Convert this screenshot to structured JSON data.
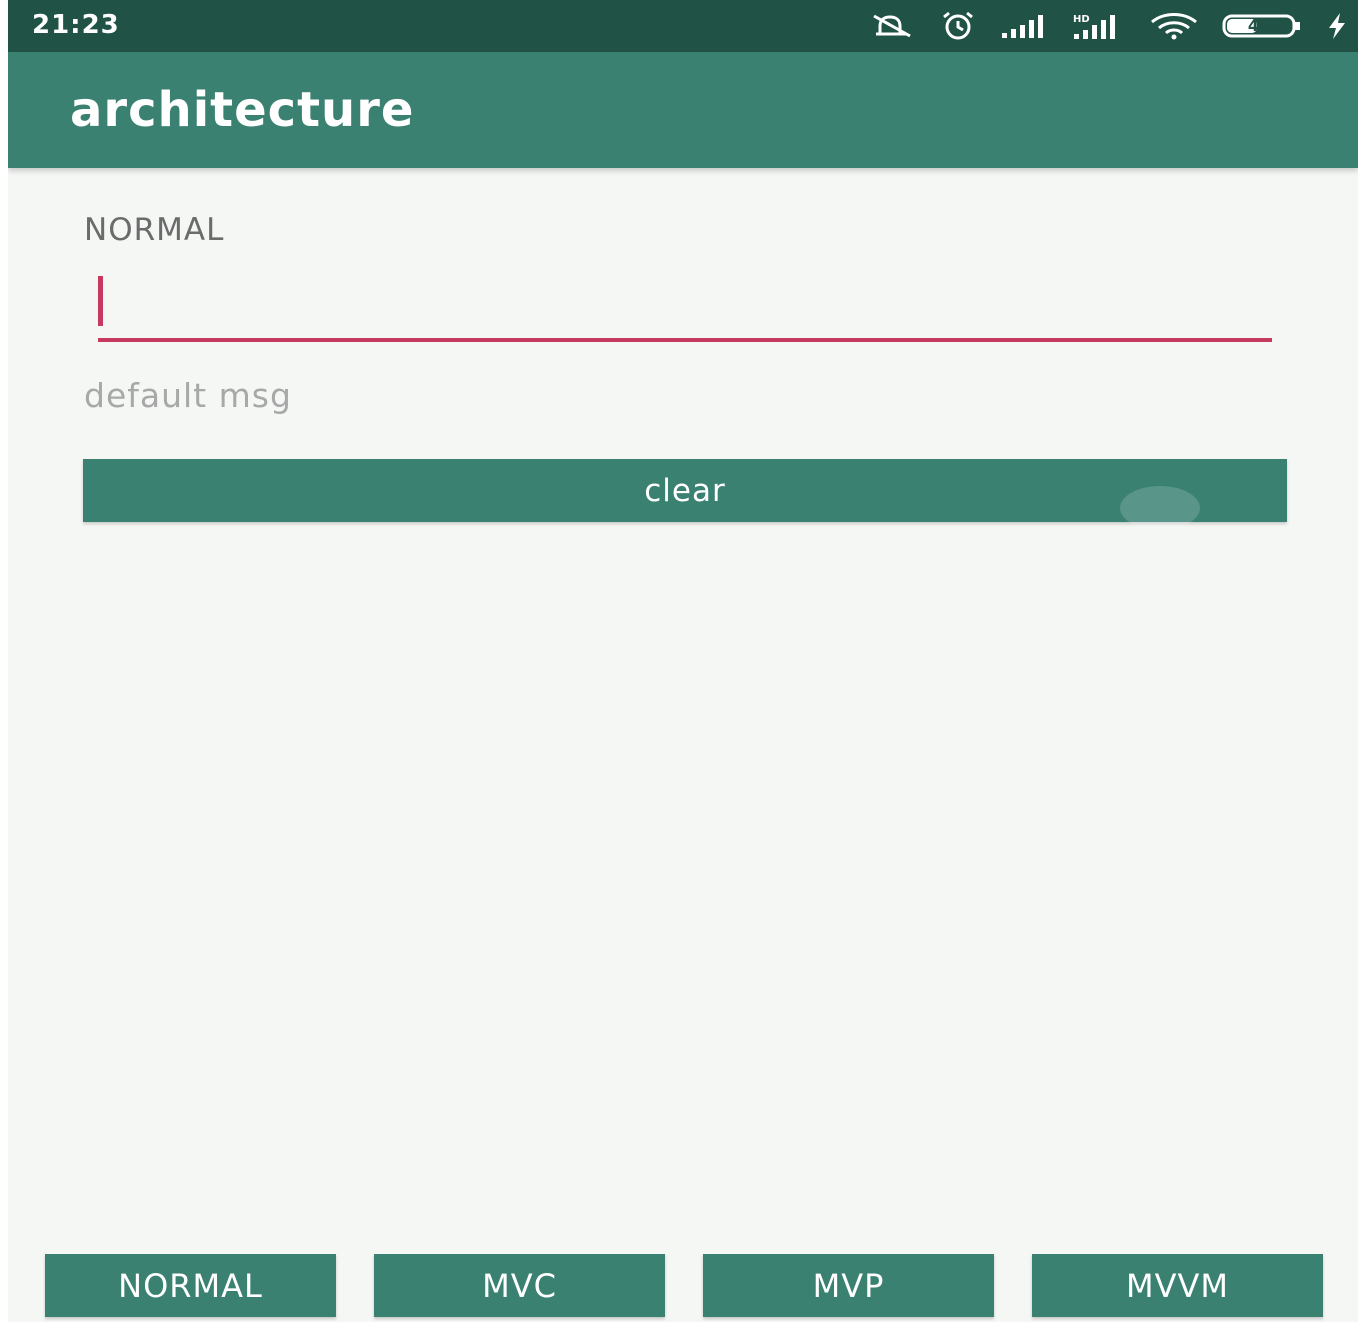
{
  "status_bar": {
    "time": "21:23",
    "icons": [
      "bell-off-icon",
      "alarm-icon",
      "signal-icon",
      "hd-signal-icon",
      "wifi-icon",
      "battery-icon",
      "charging-icon"
    ],
    "battery_level": "43"
  },
  "app_bar": {
    "title": "architecture"
  },
  "content": {
    "mode_label": "NORMAL",
    "input": {
      "value": "",
      "placeholder": ""
    },
    "message": "default msg",
    "clear_label": "clear"
  },
  "bottom_nav": {
    "items": [
      {
        "label": "NORMAL"
      },
      {
        "label": "MVC"
      },
      {
        "label": "MVP"
      },
      {
        "label": "MVVM"
      }
    ]
  },
  "colors": {
    "status_bar": "#205246",
    "primary": "#3a8172",
    "accent": "#c53a5e",
    "background": "#f5f7f5"
  }
}
